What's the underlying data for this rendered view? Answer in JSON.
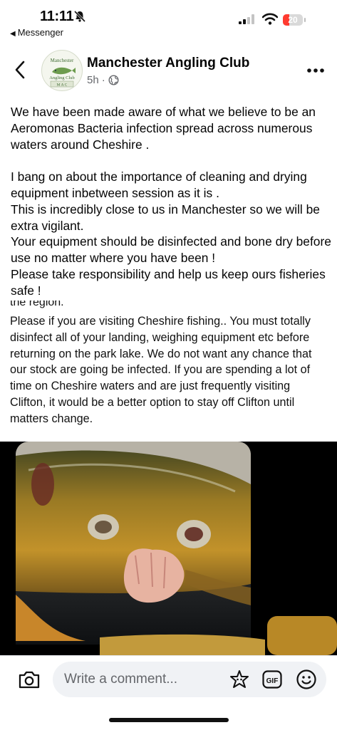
{
  "status_bar": {
    "time": "11:11",
    "back_app": "Messenger",
    "battery_percent": "20"
  },
  "post_header": {
    "page_name": "Manchester Angling Club",
    "timestamp": "5h",
    "avatar_text": {
      "top": "Manchester",
      "middle": "Angling Club",
      "bottom": "M A C"
    }
  },
  "caption": {
    "paragraph_1": "We have been made aware of what we believe to be an Aeromonas Bacteria infection spread across numerous waters around Cheshire .",
    "paragraph_2": "I bang on about the importance of cleaning and drying equipment inbetween session as it is .\nThis is incredibly close to us in Manchester so we will be extra vigilant.\nYour equipment should be disinfected and bone dry before use no matter where you have been !\nPlease take responsibility and help us keep ours fisheries safe !"
  },
  "screenshot_text": {
    "cut_line": "the region.",
    "body": "Please if you are visiting Cheshire fishing.. You must totally disinfect all of your landing, weighing equipment etc before returning on the park lake. We do not want any chance that our stock are going be infected. If you are spending a lot of time on Cheshire waters and are just frequently visiting Clifton, it would be a better option to stay off Clifton until matters change."
  },
  "composer": {
    "placeholder": "Write a comment...",
    "gif_label": "GIF"
  },
  "icons": {
    "back": "chevron-left-icon",
    "more": "more-icon",
    "privacy": "globe-icon",
    "camera": "camera-icon",
    "avatar_sticker": "avatar-sticker-icon",
    "gif": "gif-icon",
    "emoji": "smile-icon"
  },
  "colors": {
    "text": "#050505",
    "secondary_text": "#65676b",
    "input_background": "#f0f2f5",
    "battery_low": "#ff3b30"
  }
}
